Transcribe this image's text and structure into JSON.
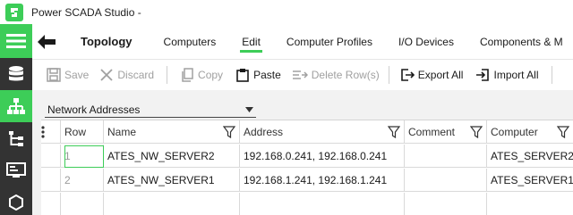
{
  "app": {
    "title": "Power SCADA Studio -"
  },
  "header": {
    "title": "Topology",
    "tabs": [
      {
        "label": "Computers",
        "active": false
      },
      {
        "label": "Edit",
        "active": true
      },
      {
        "label": "Computer Profiles",
        "active": false
      },
      {
        "label": "I/O Devices",
        "active": false
      },
      {
        "label": "Components & M",
        "active": false
      }
    ]
  },
  "toolbar": {
    "save_label": "Save",
    "discard_label": "Discard",
    "copy_label": "Copy",
    "paste_label": "Paste",
    "delete_label": "Delete Row(s)",
    "export_label": "Export All",
    "import_label": "Import All"
  },
  "filter": {
    "selected": "Network Addresses"
  },
  "grid": {
    "columns": [
      "Row",
      "Name",
      "Address",
      "Comment",
      "Computer"
    ],
    "rows": [
      {
        "row": "1",
        "name": "ATES_NW_SERVER2",
        "address": "192.168.0.241, 192.168.0.241",
        "comment": "",
        "computer": "ATES_SERVER2"
      },
      {
        "row": "2",
        "name": "ATES_NW_SERVER1",
        "address": "192.168.1.241, 192.168.1.241",
        "comment": "",
        "computer": "ATES_SERVER1"
      }
    ]
  },
  "colors": {
    "accent": "#3dcd58",
    "nav_bg": "#333333"
  }
}
